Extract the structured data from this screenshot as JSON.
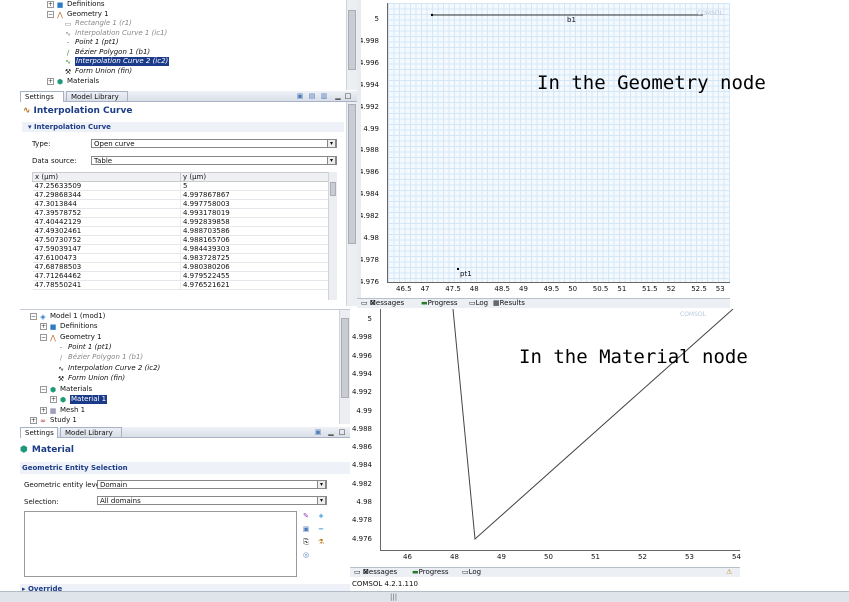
{
  "top_tree": {
    "items": [
      {
        "label": "Definitions"
      },
      {
        "label": "Geometry 1"
      },
      {
        "label": "Rectangle 1 (r1)"
      },
      {
        "label": "Interpolation Curve 1 (ic1)"
      },
      {
        "label": "Point 1 (pt1)"
      },
      {
        "label": "Bézier Polygon 1 (b1)"
      },
      {
        "label": "Interpolation Curve 2 (ic2)"
      },
      {
        "label": "Form Union (fin)"
      },
      {
        "label": "Materials"
      }
    ]
  },
  "top_tabs": {
    "settings": "Settings",
    "model_library": "Model Library"
  },
  "top_settings": {
    "title": "Interpolation Curve",
    "section": "Interpolation Curve",
    "type_label": "Type:",
    "type_value": "Open curve",
    "source_label": "Data source:",
    "source_value": "Table",
    "col_x": "x (µm)",
    "col_y": "y (µm)",
    "rows": [
      [
        "47.25633509",
        "5"
      ],
      [
        "47.29868344",
        "4.997867867"
      ],
      [
        "47.3013844",
        "4.997758003"
      ],
      [
        "47.39578752",
        "4.993178019"
      ],
      [
        "47.40442129",
        "4.992839858"
      ],
      [
        "47.49302461",
        "4.988703586"
      ],
      [
        "47.50730752",
        "4.988165706"
      ],
      [
        "47.59039147",
        "4.984439303"
      ],
      [
        "47.6100473",
        "4.983728725"
      ],
      [
        "47.68788503",
        "4.980380206"
      ],
      [
        "47.71264462",
        "4.979522455"
      ],
      [
        "47.78550241",
        "4.976521621"
      ]
    ]
  },
  "bottom_tree": {
    "items": [
      {
        "label": "Model 1 (mod1)"
      },
      {
        "label": "Definitions"
      },
      {
        "label": "Geometry 1"
      },
      {
        "label": "Point 1 (pt1)"
      },
      {
        "label": "Bézier Polygon 1 (b1)"
      },
      {
        "label": "Interpolation Curve 2 (ic2)"
      },
      {
        "label": "Form Union (fin)"
      },
      {
        "label": "Materials"
      },
      {
        "label": "Material 1"
      },
      {
        "label": "Mesh 1"
      },
      {
        "label": "Study 1"
      }
    ]
  },
  "bottom_tabs": {
    "settings": "Settings",
    "model_library": "Model Library"
  },
  "bottom_settings": {
    "title": "Material",
    "section": "Geometric Entity Selection",
    "level_label": "Geometric entity level:",
    "level_value": "Domain",
    "selection_label": "Selection:",
    "selection_value": "All domains",
    "override": "Override"
  },
  "top_plot": {
    "yticks": [
      "5",
      "4.998",
      "4.996",
      "4.994",
      "4.992",
      "4.99",
      "4.988",
      "4.986",
      "4.984",
      "4.982",
      "4.98",
      "4.978",
      "4.976"
    ],
    "xticks": [
      "46.5",
      "47",
      "47.5",
      "48",
      "48.5",
      "49",
      "49.5",
      "50",
      "50.5",
      "51",
      "51.5",
      "52",
      "52.5",
      "53"
    ],
    "label_b1": "b1",
    "label_pt1": "pt1",
    "annotation": "In the Geometry node"
  },
  "top_msg_tabs": {
    "messages": "Messages",
    "progress": "Progress",
    "log": "Log",
    "results": "Results"
  },
  "bottom_plot": {
    "yticks": [
      "5",
      "4.998",
      "4.996",
      "4.994",
      "4.992",
      "4.99",
      "4.988",
      "4.986",
      "4.984",
      "4.982",
      "4.98",
      "4.978",
      "4.976"
    ],
    "xticks": [
      "46",
      "48",
      "49",
      "50",
      "51",
      "52",
      "53",
      "54"
    ],
    "annotation": "In the Material node"
  },
  "bottom_msg_tabs": {
    "messages": "Messages",
    "progress": "Progress",
    "log": "Log"
  },
  "status": {
    "version": "COMSOL 4.2.1.110"
  },
  "colors": {
    "accent": "#1d3d88",
    "selection": "#1b3a8a",
    "grid": "#d4e6f6"
  }
}
